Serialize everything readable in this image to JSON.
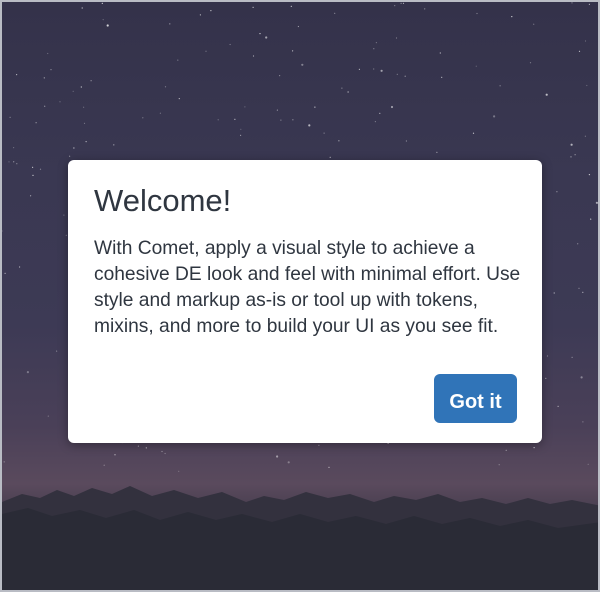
{
  "dialog": {
    "title": "Welcome!",
    "body": "With Comet, apply a visual style to achieve a cohesive DE look and feel with minimal effort. Use style and markup as-is or tool up with tokens, mixins, and more to build your UI as you see fit.",
    "button_label": "Got it"
  },
  "colors": {
    "button": "#3074b8",
    "text": "#2f3640",
    "sky_top": "#34324a",
    "horizon": "#5a4a5d",
    "mountains": "#2a2b36"
  }
}
